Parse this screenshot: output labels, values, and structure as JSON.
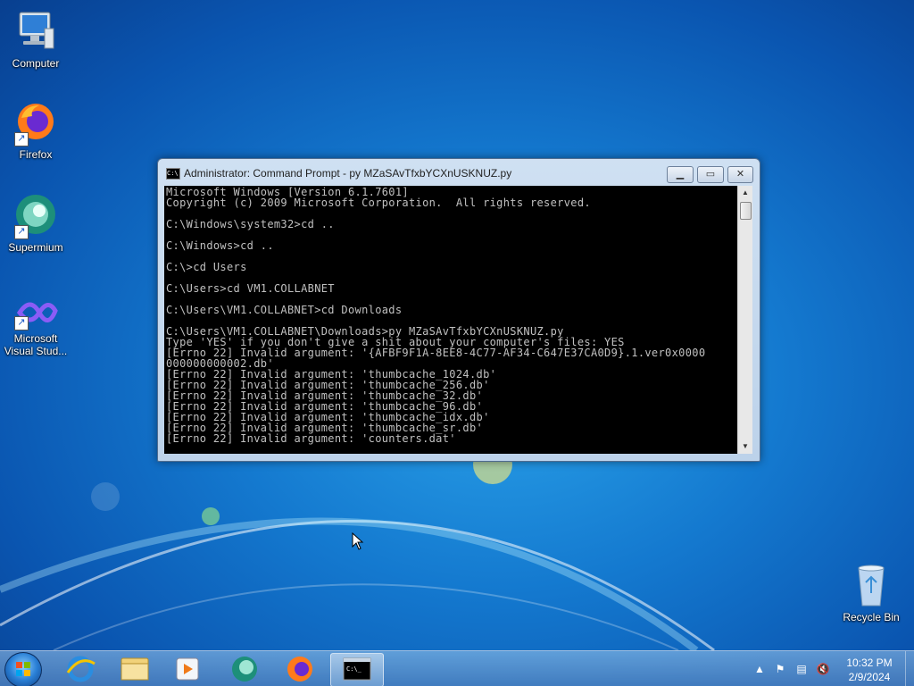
{
  "desktop": {
    "icons": [
      {
        "label": "Computer",
        "icon": "computer-icon"
      },
      {
        "label": "Firefox",
        "icon": "firefox-icon"
      },
      {
        "label": "Supermium",
        "icon": "supermium-icon"
      },
      {
        "label": "Microsoft Visual Stud...",
        "icon": "visual-studio-icon"
      },
      {
        "label": "Recycle Bin",
        "icon": "recycle-bin-icon"
      }
    ]
  },
  "cmd_window": {
    "title": "Administrator:  Command Prompt - py  MZaSAvTfxbYCXnUSKNUZ.py",
    "buttons": {
      "minimize": "minimize-icon",
      "maximize": "maximize-icon",
      "close": "close-icon"
    },
    "console_lines": [
      "Microsoft Windows [Version 6.1.7601]",
      "Copyright (c) 2009 Microsoft Corporation.  All rights reserved.",
      "",
      "C:\\Windows\\system32>cd ..",
      "",
      "C:\\Windows>cd ..",
      "",
      "C:\\>cd Users",
      "",
      "C:\\Users>cd VM1.COLLABNET",
      "",
      "C:\\Users\\VM1.COLLABNET>cd Downloads",
      "",
      "C:\\Users\\VM1.COLLABNET\\Downloads>py MZaSAvTfxbYCXnUSKNUZ.py",
      "Type 'YES' if you don't give a shit about your computer's files: YES",
      "[Errno 22] Invalid argument: '{AFBF9F1A-8EE8-4C77-AF34-C647E37CA0D9}.1.ver0x0000",
      "000000000002.db'",
      "[Errno 22] Invalid argument: 'thumbcache_1024.db'",
      "[Errno 22] Invalid argument: 'thumbcache_256.db'",
      "[Errno 22] Invalid argument: 'thumbcache_32.db'",
      "[Errno 22] Invalid argument: 'thumbcache_96.db'",
      "[Errno 22] Invalid argument: 'thumbcache_idx.db'",
      "[Errno 22] Invalid argument: 'thumbcache_sr.db'",
      "[Errno 22] Invalid argument: 'counters.dat'"
    ]
  },
  "taskbar": {
    "start": "start-orb-icon",
    "pinned": [
      "internet-explorer-icon",
      "file-explorer-icon",
      "media-player-icon",
      "supermium-icon",
      "firefox-icon",
      "cmd-icon"
    ],
    "tray": [
      "show-hidden-icons-icon",
      "action-center-flag-icon",
      "network-icon",
      "volume-muted-icon"
    ],
    "clock": {
      "time": "10:32 PM",
      "date": "2/9/2024"
    }
  },
  "colors": {
    "console_bg": "#000000",
    "console_fg": "#c0c0c0",
    "desktop_blue": "#1479cf"
  }
}
